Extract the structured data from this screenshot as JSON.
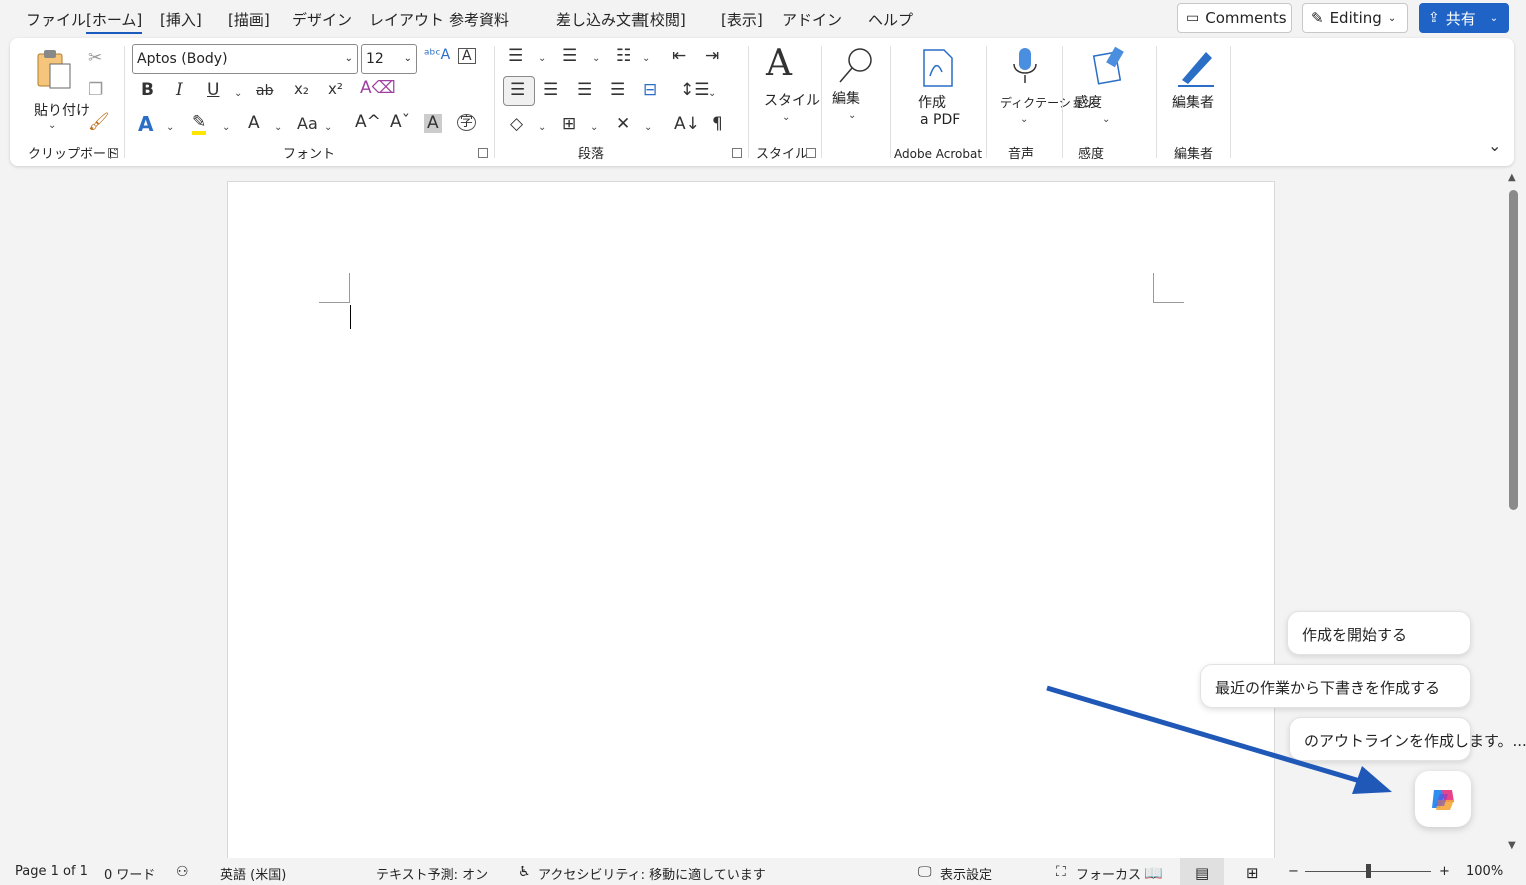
{
  "menu": {
    "tabs": [
      "ファイル",
      "[ホーム]",
      "[挿入]",
      "[描画]",
      "デザイン",
      "レイアウト",
      "参考資料",
      "差し込み文書",
      "[校閲]",
      "[表示]",
      "アドイン",
      "ヘルプ"
    ],
    "comments_label": "Comments",
    "editing_label": "Editing",
    "share_label": "共有"
  },
  "ribbon": {
    "clipboard": {
      "paste_label": "貼り付け",
      "group_label": "クリップボード"
    },
    "font": {
      "font_name": "Aptos (Body)",
      "font_size": "12",
      "group_label": "フォント",
      "bold": "B",
      "italic": "I",
      "underline": "U",
      "strike": "ab",
      "subscript": "x₂",
      "superscript": "x²",
      "font_color": "A",
      "text_effects": "A",
      "case": "Aa",
      "grow": "A^",
      "shrink": "Aˇ",
      "shade": "A",
      "phonetic": "字"
    },
    "paragraph": {
      "group_label": "段落",
      "pilcrow": "¶"
    },
    "styles": {
      "label": "スタイル",
      "group_label": "スタイル"
    },
    "editing": {
      "label": "編集"
    },
    "acrobat": {
      "label_line1": "作成",
      "label_line2": "a PDF",
      "group_label": "Adobe Acrobat"
    },
    "voice": {
      "label": "ディクテーション",
      "group_label": "音声"
    },
    "sensitivity": {
      "label": "感度",
      "group_label": "感度"
    },
    "editor": {
      "label": "編集者",
      "group_label": "編集者"
    }
  },
  "copilot": {
    "suggestions": [
      "作成を開始する",
      "最近の作業から下書きを作成する",
      "のアウトラインを作成します。..."
    ]
  },
  "status": {
    "page": "Page 1 of 1",
    "words": "0 ワード",
    "language": "英語 (米国)",
    "prediction": "テキスト予測: オン",
    "accessibility": "アクセシビリティ: 移動に適しています",
    "display_settings": "表示設定",
    "focus": "フォーカス",
    "zoom_minus": "−",
    "zoom_plus": "+",
    "zoom_percent": "100%"
  },
  "colors": {
    "accent": "#185abd",
    "share_bg": "#1f63c6",
    "annotation_arrow": "#2058b8"
  }
}
